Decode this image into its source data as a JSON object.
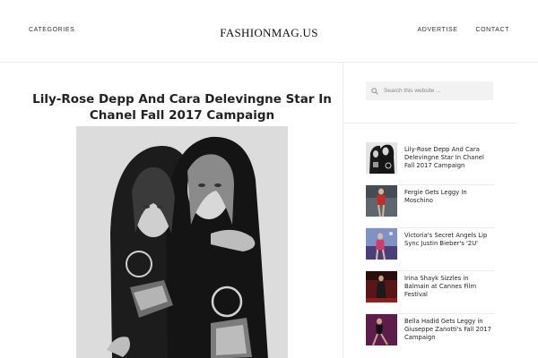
{
  "header": {
    "nav_left": "CATEGORIES",
    "logo": "FASHIONMAG.US",
    "nav_right": [
      "ADVERTISE",
      "CONTACT"
    ]
  },
  "article": {
    "title": "Lily-Rose Depp And Cara Delevingne Star In Chanel Fall 2017 Campaign"
  },
  "sidebar": {
    "search_placeholder": "Search this website ...",
    "posts": [
      {
        "title": "Lily-Rose Depp And Cara Delevingne Star In Chanel Fall 2017 Campaign"
      },
      {
        "title": "Fergie Gets Leggy In Moschino"
      },
      {
        "title": "Victoria's Secret Angels Lip Sync Justin Bieber's '2U'"
      },
      {
        "title": "Irina Shayk Sizzles in Balmain at Cannes Film Festival"
      },
      {
        "title": "Bella Hadid Gets Leggy in Giuseppe Zanotti's Fall 2017 Campaign"
      }
    ]
  }
}
